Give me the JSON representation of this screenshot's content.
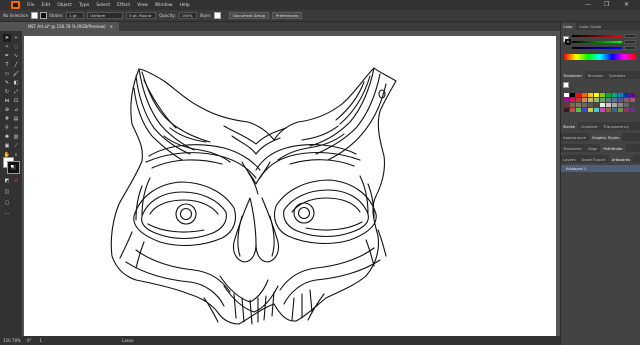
{
  "menubar": {
    "items": [
      "File",
      "Edit",
      "Object",
      "Type",
      "Select",
      "Effect",
      "View",
      "Window",
      "Help"
    ],
    "window_controls": [
      "—",
      "❐",
      "✕"
    ]
  },
  "controlbar": {
    "selection_label": "No Selection",
    "stroke_label": "Stroke:",
    "stroke_value": "1 pt",
    "profile_label": "Uniform",
    "brush_label": "5 pt. Round",
    "opacity_label": "Opacity:",
    "opacity_value": "100%",
    "style_label": "Style:",
    "document_setup_button": "Document Setup",
    "preferences_button": "Preferences"
  },
  "document": {
    "tab_title": "NST Art.ai* @ 156.78 % (RGB/Preview)",
    "close_glyph": "✕"
  },
  "statusbar": {
    "zoom": "156.78%",
    "angle": "0°",
    "artboard_number": "1",
    "tool_name": "Lasso"
  },
  "panels": {
    "color_tabs": [
      "Color",
      "Color Guide"
    ],
    "properties_tabs": [
      "Transform",
      "Brushes",
      "Symbols"
    ],
    "stroke_tabs": [
      "Stroke",
      "Gradient",
      "Transparency"
    ],
    "appearance_tabs": [
      "Appearance",
      "Graphic Styles"
    ],
    "transform_tabs": [
      "Transform",
      "Align",
      "Pathfinder"
    ],
    "layers_tabs": [
      "Layers",
      "Asset Export",
      "Artboards"
    ],
    "artboard_item": "Artboard 1"
  },
  "colors": {
    "accent": "#ff6a00",
    "chrome": "#323232",
    "canvas": "#535353"
  }
}
